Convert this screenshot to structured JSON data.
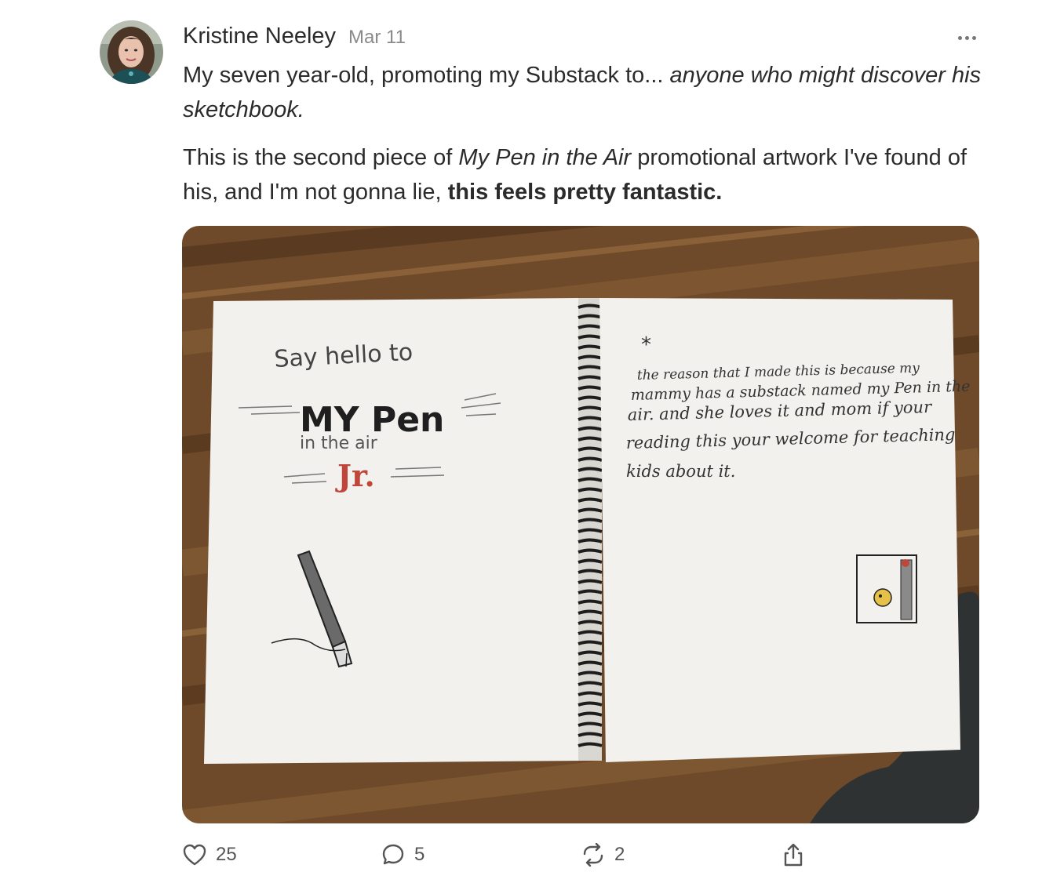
{
  "author": {
    "name": "Kristine Neeley",
    "date": "Mar 11",
    "avatar_icon": "user-avatar-photo"
  },
  "menu": {
    "icon": "more-horizontal-icon"
  },
  "body": {
    "p1_part1": "My seven year-old, promoting my Substack to... ",
    "p1_italic": "anyone who might discover his sketchbook.",
    "p2_part1": "This is the second piece of ",
    "p2_italic": "My Pen in the Air",
    "p2_part2": " promotional artwork I've found of his, and I'm not gonna lie, ",
    "p2_bold": "this feels pretty fantastic."
  },
  "image": {
    "left_page": {
      "line1": "Say hello to",
      "line2": "MY Pen",
      "line3": "in the air",
      "line4": "Jr."
    },
    "right_page": {
      "mark": "*",
      "lines": [
        "the reason that I made this is because my",
        "mammy has a substack named my Pen in the",
        "air. and she loves it and mom if your",
        "reading this your welcome for teaching",
        "kids about it."
      ]
    }
  },
  "actions": {
    "likes": "25",
    "comments": "5",
    "restacks": "2",
    "like_icon": "heart-icon",
    "comment_icon": "comment-bubble-icon",
    "restack_icon": "restack-icon",
    "share_icon": "share-icon"
  },
  "colors": {
    "text": "#2b2b2b",
    "muted": "#8a8a8a",
    "icon": "#555555",
    "junior_red": "#c0463b"
  }
}
